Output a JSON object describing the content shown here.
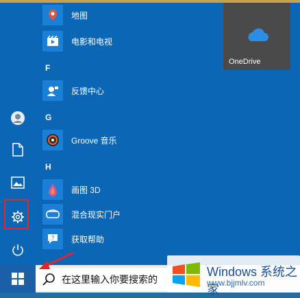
{
  "start_menu": {
    "apps": [
      {
        "label": "地图",
        "icon": "map-pin-icon",
        "color": "#e6553a"
      },
      {
        "label": "电影和电视",
        "icon": "film-icon",
        "color": "#1a7fd6"
      },
      {
        "label": "反馈中心",
        "icon": "feedback-icon",
        "color": "#1a7fd6"
      },
      {
        "label": "Groove 音乐",
        "icon": "groove-icon",
        "color": "#1a7fd6"
      },
      {
        "label": "画图 3D",
        "icon": "paint3d-icon",
        "color": "#1a7fd6"
      },
      {
        "label": "混合现实门户",
        "icon": "vr-headset-icon",
        "color": "#1a7fd6"
      },
      {
        "label": "获取帮助",
        "icon": "help-icon",
        "color": "#1a7fd6"
      }
    ],
    "section_letters": [
      "F",
      "G",
      "H"
    ],
    "tiles": [
      {
        "label": "OneDrive",
        "icon": "cloud-icon"
      }
    ],
    "rail": [
      "user-icon",
      "document-icon",
      "pictures-icon",
      "settings-icon",
      "power-icon"
    ]
  },
  "taskbar": {
    "search_text": "在这里输入你要搜索的"
  },
  "watermark": {
    "title": "Windows 系统之家",
    "subtitle": "www.bjjmlv.com"
  },
  "colors": {
    "start_bg": "#0c66b6",
    "highlight": "#e0262b"
  }
}
